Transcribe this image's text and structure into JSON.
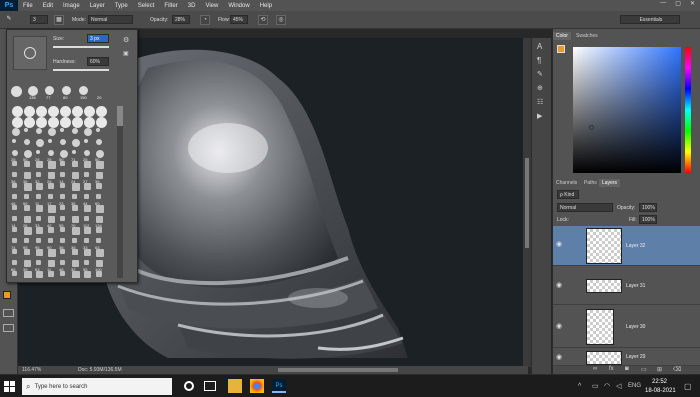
{
  "menu": {
    "logo": "Ps",
    "items": [
      "File",
      "Edit",
      "Image",
      "Layer",
      "Type",
      "Select",
      "Filter",
      "3D",
      "View",
      "Window",
      "Help"
    ]
  },
  "options": {
    "mode_label": "Mode:",
    "mode_value": "Normal",
    "opacity_label": "Opacity:",
    "opacity_value": "28%",
    "flow_label": "Flow:",
    "flow_value": "45%",
    "brush_size": "3",
    "workspace": "Essentials"
  },
  "brush_picker": {
    "size_label": "Size:",
    "size_value": "3 px",
    "hardness_label": "Hardness:",
    "hardness_value": "60%",
    "preset_sizes": [
      "136",
      "77",
      "80",
      "150",
      "20"
    ],
    "grid_numbers": [
      "25",
      "50",
      "25",
      "25",
      "50",
      "71",
      "25",
      "50",
      "36",
      "36",
      "32",
      "25",
      "14",
      "24",
      "27",
      "39",
      "46",
      "59",
      "11",
      "17",
      "23",
      "36",
      "44",
      "60",
      "14",
      "26",
      "33",
      "42",
      "55",
      "70",
      "112",
      "134",
      "74",
      "95",
      "95",
      "90",
      "36",
      "36",
      "33",
      "63",
      "66",
      "39",
      "63",
      "11",
      "48",
      "32",
      "55",
      "100"
    ]
  },
  "status": {
    "zoom": "116.47%",
    "doc": "Doc: 5.93M/136.5M"
  },
  "color_panel": {
    "tabs": [
      "Color",
      "Swatches"
    ]
  },
  "layers_panel": {
    "tabs": [
      "Channels",
      "Paths",
      "Layers"
    ],
    "kind": "ρ Kind",
    "blend": "Normal",
    "opacity_label": "Opacity:",
    "opacity_value": "100%",
    "lock_label": "Lock:",
    "fill_label": "Fill:",
    "fill_value": "100%",
    "layers": [
      {
        "name": "Layer 32",
        "selected": true
      },
      {
        "name": "Layer 31"
      },
      {
        "name": "Layer 30"
      },
      {
        "name": "Layer 29"
      }
    ]
  },
  "taskbar": {
    "search_placeholder": "Type here to search",
    "lang": "ENG",
    "time": "22:52",
    "date": "18-08-2021"
  },
  "colors": {
    "foreground": "#e89a2e",
    "background": "#ffffff"
  }
}
